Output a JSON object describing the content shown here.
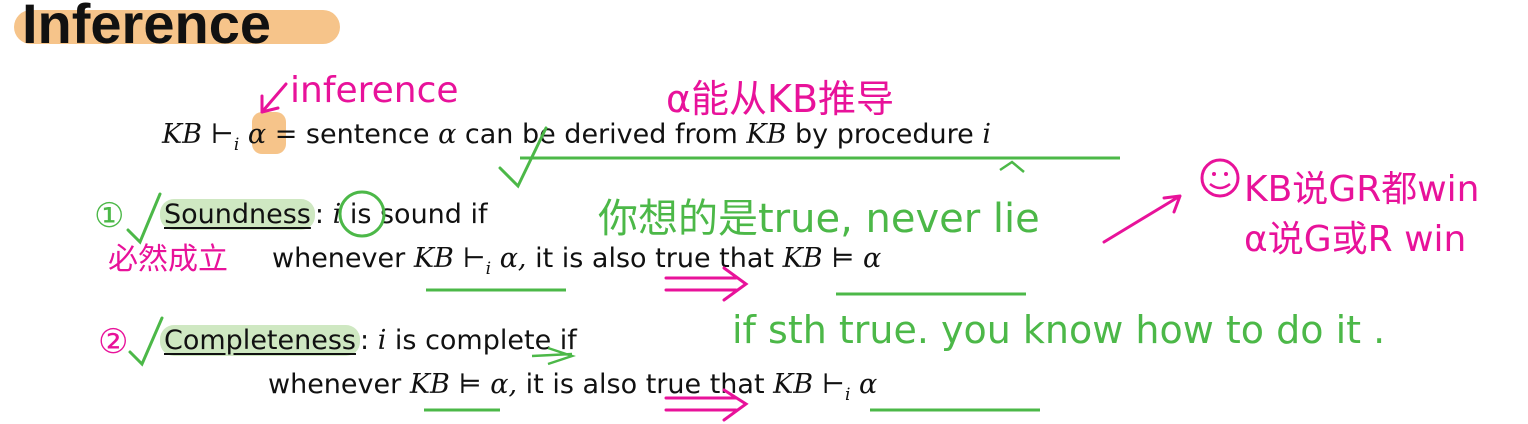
{
  "slide": {
    "title": "Inference"
  },
  "statements": {
    "definition": {
      "kb": "KB",
      "turnstile": "⊢",
      "sub": "i",
      "alpha": "α",
      "equals": "=",
      "text1": "sentence",
      "alpha2": "α",
      "text2": "can be derived from",
      "kb2": "KB",
      "text3": "by procedure",
      "proc": "i"
    },
    "soundness": {
      "term": "Soundness",
      "colon": ":",
      "i": "i",
      "rest": "is sound if",
      "line2_prefix": "whenever",
      "kb": "KB",
      "turnstile": "⊢",
      "sub": "i",
      "alpha": "α,",
      "mid": "it is also true that",
      "kb2": "KB",
      "entails": "⊨",
      "alpha2": "α"
    },
    "completeness": {
      "term": "Completeness",
      "colon": ":",
      "i": "i",
      "rest": "is complete if",
      "line2_prefix": "whenever",
      "kb": "KB",
      "entails": "⊨",
      "alpha": "α,",
      "mid": "it is also true that",
      "kb2": "KB",
      "turnstile": "⊢",
      "sub": "i",
      "alpha2": "α"
    }
  },
  "annotations": {
    "inference_note": "inference",
    "derive_note": "α能从KB推导",
    "sound_marker": "①",
    "sound_chinese": "必然成立",
    "sound_note": "你想的是true, never lie",
    "win_line1": "KB说GR都win",
    "win_line2": "α说G或R win",
    "complete_marker": "②",
    "complete_note": "if sth true. you know how to do it ."
  },
  "colors": {
    "title_highlight": "#f6c48a",
    "term_highlight": "#cfe8c2",
    "ink_magenta": "#e8129a",
    "ink_green": "#4cb848"
  }
}
